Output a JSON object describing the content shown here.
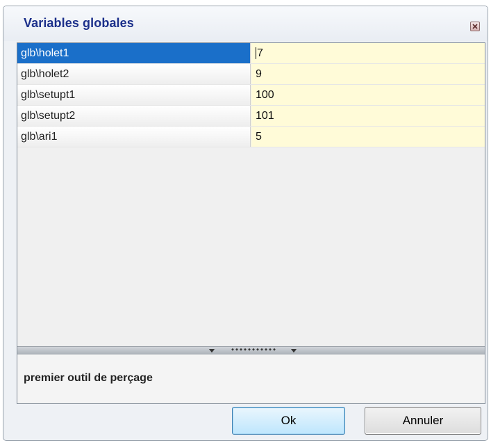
{
  "window": {
    "title": "Variables globales"
  },
  "grid": {
    "rows": [
      {
        "name": "glb\\holet1",
        "value": "7",
        "selected": true
      },
      {
        "name": "glb\\holet2",
        "value": "9"
      },
      {
        "name": "glb\\setupt1",
        "value": "100"
      },
      {
        "name": "glb\\setupt2",
        "value": "101"
      },
      {
        "name": "glb\\ari1",
        "value": "5"
      }
    ]
  },
  "description": {
    "text": "premier outil de perçage"
  },
  "buttons": {
    "ok_label": "Ok",
    "cancel_label": "Annuler"
  },
  "colors": {
    "title": "#1b2f8a",
    "selected_row": "#1a6fc9",
    "value_cell": "#fffbd8"
  }
}
